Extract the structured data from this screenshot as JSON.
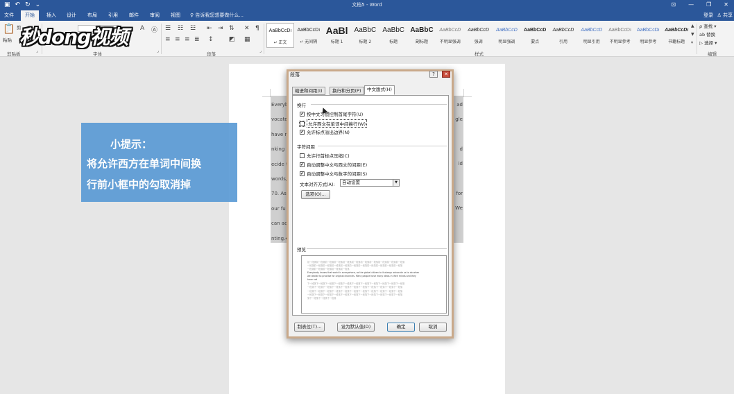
{
  "titlebar": {
    "title": "文档5 - Word",
    "qat_icons": [
      "save-icon",
      "undo-icon",
      "redo-icon",
      "customize-icon"
    ],
    "qat_glyphs": [
      "▣",
      "↶",
      "↻",
      "⌄"
    ],
    "window_glyphs": [
      "⊡",
      "—",
      "❐",
      "✕"
    ]
  },
  "tabs": {
    "items": [
      "文件",
      "开始",
      "插入",
      "设计",
      "布局",
      "引用",
      "邮件",
      "审阅",
      "视图"
    ],
    "active": "开始",
    "tellme": "♀ 告诉我您想要做什么...",
    "signin": "登录",
    "share": "♙ 共享"
  },
  "ribbon": {
    "groups": {
      "clipboard": "剪贴板",
      "font": "字体",
      "paragraph": "段落",
      "styles": "样式",
      "editing": "编辑"
    },
    "paste_label": "粘贴",
    "cut_label": "剪",
    "styles": [
      {
        "sample": "AaBbCcDı",
        "name": "↵ 正文",
        "size": 7
      },
      {
        "sample": "AaBbCcDı",
        "name": "↵ 无间隔",
        "size": 7
      },
      {
        "sample": "AaBl",
        "name": "标题 1",
        "size": 14,
        "bold": true
      },
      {
        "sample": "AaBbC",
        "name": "标题 2",
        "size": 10
      },
      {
        "sample": "AaBbC",
        "name": "标题",
        "size": 10
      },
      {
        "sample": "AaBbC",
        "name": "副标题",
        "size": 10,
        "bold": true
      },
      {
        "sample": "AaBbCcD",
        "name": "不明显强调",
        "size": 7,
        "italic": true,
        "color": "#777777"
      },
      {
        "sample": "AaBbCcD",
        "name": "强调",
        "size": 7,
        "italic": true
      },
      {
        "sample": "AaBbCcD",
        "name": "明显强调",
        "size": 7,
        "italic": true,
        "color": "#4472c4"
      },
      {
        "sample": "AaBbCcD",
        "name": "要点",
        "size": 7,
        "bold": true
      },
      {
        "sample": "AaBbCcD",
        "name": "引用",
        "size": 7,
        "italic": true
      },
      {
        "sample": "AaBbCcD",
        "name": "明显引用",
        "size": 7,
        "italic": true,
        "color": "#4472c4"
      },
      {
        "sample": "AaBbCcDı",
        "name": "不明显参考",
        "size": 7,
        "color": "#777777"
      },
      {
        "sample": "AaBbCcDı",
        "name": "明显参考",
        "size": 7,
        "color": "#4472c4"
      },
      {
        "sample": "AaBbCcDı",
        "name": "书籍标题",
        "size": 7,
        "bold": true,
        "italic": true
      }
    ],
    "editing": {
      "find": "ρ 查找 ▾",
      "replace": "ab 替换",
      "select": "▷ 选择 ▾"
    }
  },
  "watermark": "秒dong视频",
  "tip": {
    "line1": "小提示：",
    "line2": "将允许西方在单词中间换",
    "line3": "行前小框中的勾取消掉"
  },
  "document": {
    "left_fragments": [
      "Everyb",
      "vocate",
      "have n",
      "nking",
      "ecide t",
      "words, s",
      "70. As",
      "our fu",
      "can ac",
      "nting.↵"
    ],
    "right_fragments": [
      "ad",
      "gle",
      "d",
      "id",
      "for",
      "We"
    ]
  },
  "dialog": {
    "title": "段落",
    "help": "?",
    "close": "✕",
    "tabs": [
      "缩进和间距(I)",
      "换行和分页(P)",
      "中文版式(H)"
    ],
    "active_tab": "中文版式(H)",
    "line_break": {
      "title": "换行",
      "options": [
        {
          "label": "按中文习惯控制首尾字符(U)",
          "checked": true
        },
        {
          "label": "允许西文在单词中间换行(W)",
          "checked": false
        },
        {
          "label": "允许标点溢出边界(N)",
          "checked": true
        }
      ]
    },
    "char_spacing": {
      "title": "字符间距",
      "options": [
        {
          "label": "允许行首标点压缩(C)",
          "checked": false
        },
        {
          "label": "自动调整中文与西文的间距(E)",
          "checked": true
        },
        {
          "label": "自动调整中文与数字的间距(S)",
          "checked": true
        }
      ]
    },
    "align_label": "文本对齐方式(A):",
    "align_value": "自动设置",
    "options_button": "选项(O)...",
    "preview_title": "预览",
    "preview_sample_lines": [
      "前一段落前一段落前一段落前一段落前一段落前一段落前一段落前一段落前一段落前一段落前一段落",
      "一段落前一段落前一段落前一段落前一段落前一段落前一段落前一段落前一段落前一段落前一段落",
      "一段落前一段落前一段落前一段落前一段落",
      "Everybody knows that world is everywhere, as the global citizen to it always advocate us to do when",
      "we decide to practise for original channels. Many people have many ideas in their minds and they",
      "have not",
      "下一段落下一段落下一段落下一段落下一段落下一段落下一段落下一段落下一段落下一段落下一段落",
      "一段落下一段落下一段落下一段落下一段落下一段落下一段落下一段落下一段落下一段落下一段落",
      "一段落下一段落下一段落下一段落下一段落下一段落下一段落下一段落下一段落下一段落下一段落",
      "一段落下一段落下一段落下一段落下一段落下一段落下一段落下一段落下一段落下一段落下一段落",
      "落下一段落下一段落下一段落"
    ],
    "buttons": {
      "tabs": "制表位(T)...",
      "default": "设为默认值(D)",
      "ok": "确定",
      "cancel": "取消"
    }
  }
}
